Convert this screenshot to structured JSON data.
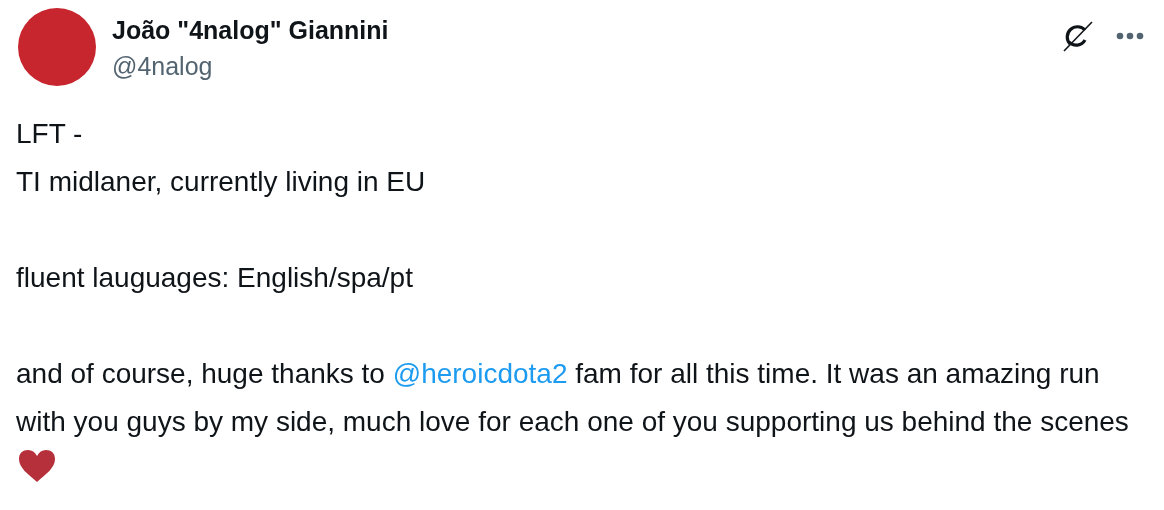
{
  "author": {
    "name": "João \"4nalog\" Giannini",
    "handle": "@4nalog"
  },
  "body": [
    {
      "lines": [
        "LFT -",
        "TI midlaner, currently living in EU"
      ]
    },
    {
      "lines": [
        "fluent lauguages: English/spa/pt"
      ]
    },
    {
      "before": "and of course, huge thanks to ",
      "mention": "@heroicdota2",
      "after": " fam for all this time. It was an amazing run with you guys by my side, much love for each one of you supporting us behind the scenes"
    }
  ]
}
